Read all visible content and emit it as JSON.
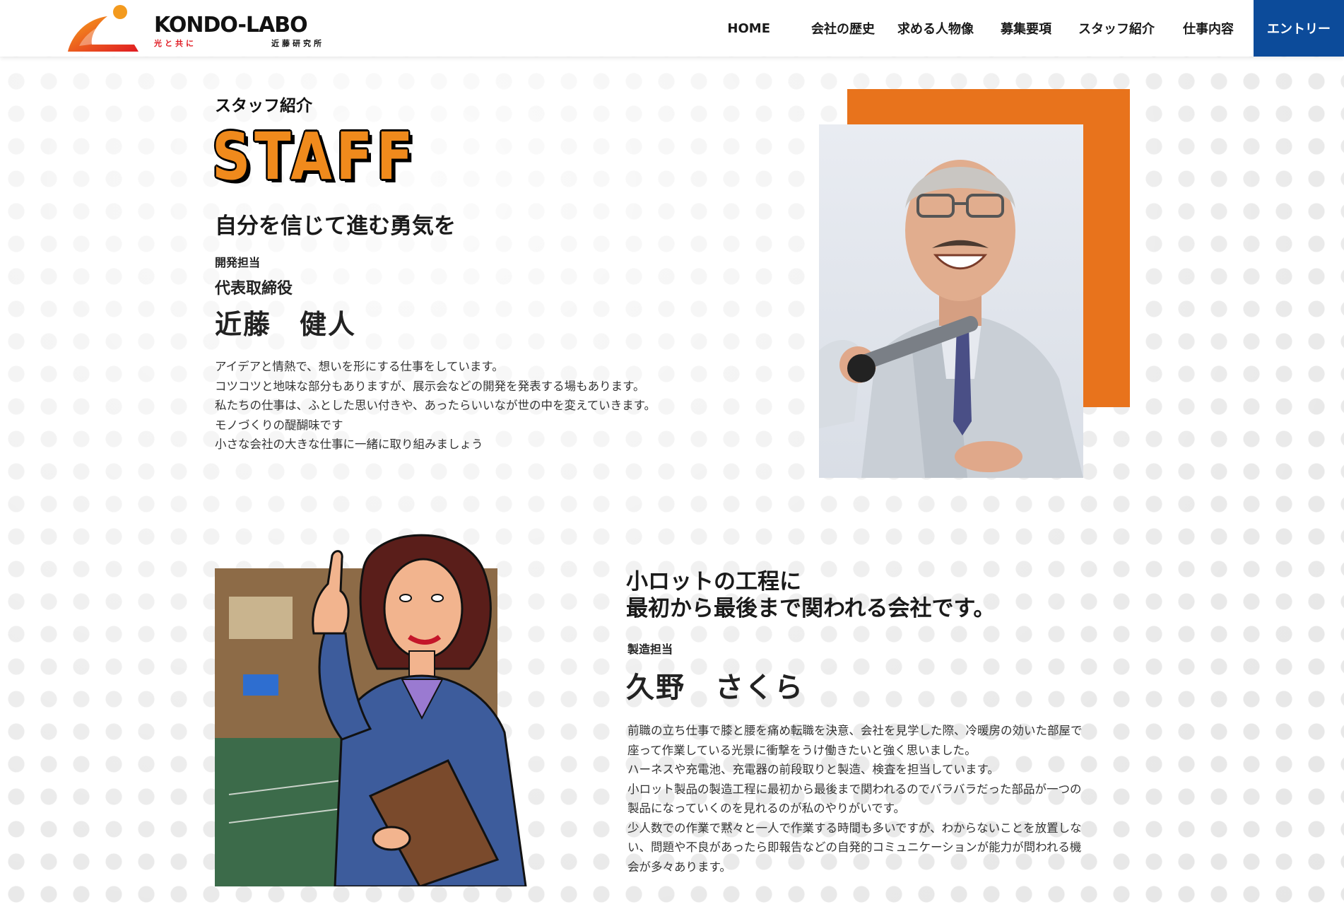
{
  "header": {
    "logo": {
      "wordmark": "KONDO-LABO",
      "tagline": "光と共に",
      "subtitle": "近藤研究所"
    },
    "nav": [
      {
        "label": "HOME",
        "name": "nav-home"
      },
      {
        "label": "会社の歴史",
        "name": "nav-history"
      },
      {
        "label": "求める人物像",
        "name": "nav-ideal-person"
      },
      {
        "label": "募集要項",
        "name": "nav-requirements"
      },
      {
        "label": "スタッフ紹介",
        "name": "nav-staff"
      },
      {
        "label": "仕事内容",
        "name": "nav-work"
      }
    ],
    "entry_label": "エントリー"
  },
  "section1": {
    "label": "スタッフ紹介",
    "title": "STAFF",
    "headline": "自分を信じて進む勇気を",
    "department": "開発担当",
    "role": "代表取締役",
    "name": "近藤　健人",
    "body": [
      "アイデアと情熱で、想いを形にする仕事をしています。",
      "コツコツと地味な部分もありますが、展示会などの開発を発表する場もあります。",
      "私たちの仕事は、ふとした思い付きや、あったらいいなが世の中を変えていきます。",
      "モノづくりの醍醐味です",
      "小さな会社の大きな仕事に一緒に取り組みましょう"
    ]
  },
  "section2": {
    "headline_lines": [
      "小ロットの工程に",
      "最初から最後まで関われる会社です。"
    ],
    "department": "製造担当",
    "name": "久野　さくら",
    "body": [
      "前職の立ち仕事で膝と腰を痛め転職を決意、会社を見学した際、冷暖房の効いた部屋で",
      "座って作業している光景に衝撃をうけ働きたいと強く思いました。",
      "ハーネスや充電池、充電器の前段取りと製造、検査を担当しています。",
      "小ロット製品の製造工程に最初から最後まで関われるのでバラバラだった部品が一つの",
      "製品になっていくのを見れるのが私のやりがいです。",
      "少人数での作業で黙々と一人で作業する時間も多いですが、わからないことを放置しな",
      "い、問題や不良があったら即報告などの自発的コミュニケーションが能力が問われる機",
      "会が多々あります。"
    ]
  },
  "colors": {
    "accent_orange": "#e8731c",
    "entry_blue": "#0c4b9a",
    "logo_red": "#e01a22"
  }
}
